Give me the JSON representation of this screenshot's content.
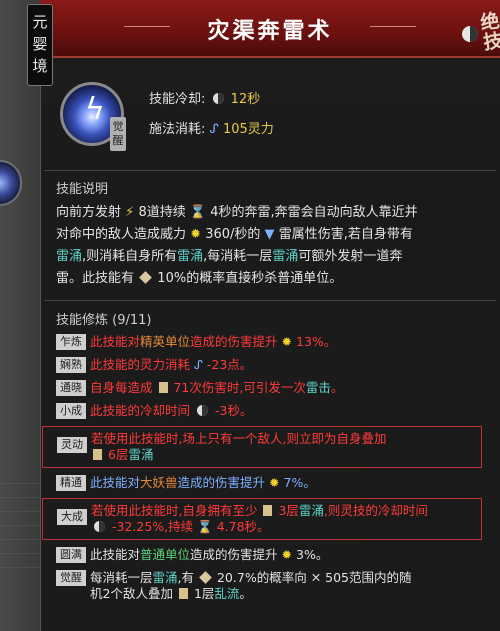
{
  "header": {
    "title": "灾渠奔雷术",
    "corner_glyphs": "绝技"
  },
  "realm": "元婴境",
  "skill": {
    "awaken_badge": "觉醒",
    "cooldown_label": "技能冷却:",
    "cooldown_value": "12秒",
    "cost_label": "施法消耗:",
    "cost_value": "105灵力"
  },
  "description": {
    "title": "技能说明",
    "p1": "向前方发射",
    "v1": "8道持续",
    "v2": "4秒的奔雷,奔雷会自动向敌人靠近并",
    "p2": "对命中的敌人造成威力",
    "v3": "360/秒的",
    "v4": "雷属性伤害,若自身带有",
    "p3a": "雷涌",
    "p3b": ",则消耗自身所有",
    "p3c": "雷涌",
    "p3d": ",每消耗一层",
    "p3e": "雷涌",
    "p3f": "可额外发射一道奔",
    "p4a": "雷。此技能有",
    "p4b": "10%的概率直接秒杀普通单位。"
  },
  "mods": {
    "title": "技能修炼 (9/11)",
    "items": [
      {
        "tag": "乍炼",
        "a": "此技能对",
        "b": "精英单位",
        "c": "造成的伤害提升",
        "d": "13%。"
      },
      {
        "tag": "娴熟",
        "a": "此技能的灵力消耗",
        "b": "-23点。"
      },
      {
        "tag": "通晓",
        "a": "自身每造成",
        "b": "71次伤害时,可引发一次",
        "c": "雷击",
        "d": "。"
      },
      {
        "tag": "小成",
        "a": "此技能的冷却时间",
        "b": "-3秒。"
      },
      {
        "tag": "灵动",
        "a": "若使用此技能时,场上只有一个敌人,则立即为自身叠加",
        "b": "6层",
        "c": "雷涌"
      },
      {
        "tag": "精通",
        "a": "此技能对",
        "b": "大妖兽",
        "c": "造成的伤害提升",
        "d": "7%。"
      },
      {
        "tag": "大成",
        "a": "若使用此技能时,自身拥有至少",
        "b": "3层",
        "c": "雷涌",
        "d": ",则灵技的冷却时间",
        "e": "-32.25%,持续",
        "f": "4.78秒。"
      },
      {
        "tag": "圆满",
        "a": "此技能对",
        "b": "普通单位",
        "c": "造成的伤害提升",
        "d": "3%。"
      },
      {
        "tag": "觉醒",
        "a": "每消耗一层",
        "b": "雷涌",
        "c": ",有",
        "d": "20.7%的概率向",
        "e": "505范围内的随",
        "f": "机2个敌人叠加",
        "g": "1层",
        "h": "乱流",
        "i": "。"
      }
    ]
  }
}
